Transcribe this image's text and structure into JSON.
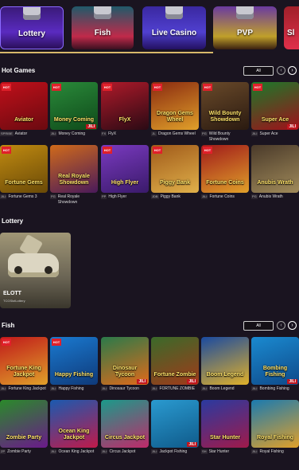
{
  "tabs": [
    {
      "label": "Lottery",
      "color": "#5a2bc0"
    },
    {
      "label": "Fish",
      "color": "#c02a4a"
    },
    {
      "label": "Live Casino",
      "color": "#5040d0"
    },
    {
      "label": "PVP",
      "color": "#c0a02a"
    },
    {
      "label": "Sl",
      "color": "#e0304a"
    }
  ],
  "hot_games": {
    "title": "Hot Games",
    "all_label": "All",
    "prev_icon": "chevron-left-icon",
    "next_icon": "chevron-right-icon",
    "games": [
      {
        "name": "Aviator",
        "provider": "SPRIBE",
        "art_text": "Aviator",
        "colors": [
          "#c0101a",
          "#6a0a10"
        ],
        "hot": true,
        "jili": false
      },
      {
        "name": "Money Coming",
        "provider": "JILI",
        "art_text": "Money Coming",
        "colors": [
          "#2a8a3a",
          "#0f4a1a"
        ],
        "hot": true,
        "jili": true
      },
      {
        "name": "FlyX",
        "provider": "FX",
        "art_text": "FlyX",
        "colors": [
          "#b01a2a",
          "#2a0a14"
        ],
        "hot": true,
        "jili": false
      },
      {
        "name": "Dragon Gems Wheel",
        "provider": "JL",
        "art_text": "Dragon Gems Wheel",
        "colors": [
          "#8a2a10",
          "#e0a02a"
        ],
        "hot": true,
        "jili": false
      },
      {
        "name": "Wild Bounty Showdown",
        "provider": "PG",
        "art_text": "Wild Bounty Showdown",
        "colors": [
          "#6a4a2a",
          "#2a1a10"
        ],
        "hot": true,
        "jili": false
      },
      {
        "name": "Super Ace",
        "provider": "JILI",
        "art_text": "Super Ace",
        "colors": [
          "#1a7a2a",
          "#a0101a"
        ],
        "hot": true,
        "jili": true
      },
      {
        "name": "Fortune Gems 3",
        "provider": "JILI",
        "art_text": "Fortune Gems",
        "colors": [
          "#c08a10",
          "#6a4a08"
        ],
        "hot": true,
        "jili": false
      },
      {
        "name": "Real Royale Showdown",
        "provider": "PG",
        "art_text": "Real Royale Showdown",
        "colors": [
          "#d06a1a",
          "#4a1a5a"
        ],
        "hot": false,
        "jili": false
      },
      {
        "name": "High Flyer",
        "provider": "PP",
        "art_text": "High Flyer",
        "colors": [
          "#7a3ac0",
          "#3a1a6a"
        ],
        "hot": true,
        "jili": false
      },
      {
        "name": "Piggy Bank",
        "provider": "JDB",
        "art_text": "Piggy Bank",
        "colors": [
          "#a05a1a",
          "#e0b04a"
        ],
        "hot": true,
        "jili": false
      },
      {
        "name": "Fortune Coins",
        "provider": "JILI",
        "art_text": "Fortune Coins",
        "colors": [
          "#a01a1a",
          "#e0a02a"
        ],
        "hot": true,
        "jili": false
      },
      {
        "name": "Anubis Wrath",
        "provider": "PG",
        "art_text": "Anubis Wrath",
        "colors": [
          "#4a3a2a",
          "#a08a5a"
        ],
        "hot": false,
        "jili": false
      }
    ]
  },
  "lottery": {
    "title": "Lottery",
    "card": {
      "name": "ELOTT",
      "subtitle": "TCGSlotLottery"
    }
  },
  "fish": {
    "title": "Fish",
    "all_label": "All",
    "games": [
      {
        "name": "Fortune King Jackpot",
        "provider": "JILI",
        "art_text": "Fortune King Jackpot",
        "colors": [
          "#c01a1a",
          "#e0a02a"
        ],
        "hot": true,
        "jili": false
      },
      {
        "name": "Happy Fishing",
        "provider": "JILI",
        "art_text": "Happy Fishing",
        "colors": [
          "#1a7ad0",
          "#0f3a7a"
        ],
        "hot": true,
        "jili": false
      },
      {
        "name": "Dinosaur Tycoon",
        "provider": "JILI",
        "art_text": "Dinosaur Tycoon",
        "colors": [
          "#2a7a4a",
          "#e06a1a"
        ],
        "hot": false,
        "jili": true
      },
      {
        "name": "FORTUNE ZOMBIE",
        "provider": "JILI",
        "art_text": "Fortune Zombie",
        "colors": [
          "#3a6a2a",
          "#a03a1a"
        ],
        "hot": false,
        "jili": true
      },
      {
        "name": "Boom Legend",
        "provider": "JILI",
        "art_text": "Boom Legend",
        "colors": [
          "#1a4aa0",
          "#e0b02a"
        ],
        "hot": false,
        "jili": false
      },
      {
        "name": "Bombing Fishing",
        "provider": "JILI",
        "art_text": "Bombing Fishing",
        "colors": [
          "#1a8ad0",
          "#0f4a8a"
        ],
        "hot": false,
        "jili": true
      },
      {
        "name": "Zombie Party",
        "provider": "ZP",
        "art_text": "Zombie Party",
        "colors": [
          "#2a8a2a",
          "#6a1a8a"
        ],
        "hot": false,
        "jili": false
      },
      {
        "name": "Ocean King Jackpot",
        "provider": "JILI",
        "art_text": "Ocean King Jackpot",
        "colors": [
          "#1a5ab0",
          "#c01a4a"
        ],
        "hot": false,
        "jili": false
      },
      {
        "name": "Circus Jackpot",
        "provider": "JILI",
        "art_text": "Circus Jackpot",
        "colors": [
          "#1a9a8a",
          "#c02a6a"
        ],
        "hot": false,
        "jili": false
      },
      {
        "name": "Jackpot Fishing",
        "provider": "JILI",
        "art_text": "",
        "colors": [
          "#2a9ad0",
          "#0f5a8a"
        ],
        "hot": false,
        "jili": true
      },
      {
        "name": "Star Hunter",
        "provider": "SH",
        "art_text": "Star Hunter",
        "colors": [
          "#2a3aa0",
          "#a01a4a"
        ],
        "hot": false,
        "jili": false
      },
      {
        "name": "Royal Fishing",
        "provider": "JILI",
        "art_text": "Royal Fishing",
        "colors": [
          "#1a7ab0",
          "#e0a02a"
        ],
        "hot": false,
        "jili": false
      }
    ]
  }
}
